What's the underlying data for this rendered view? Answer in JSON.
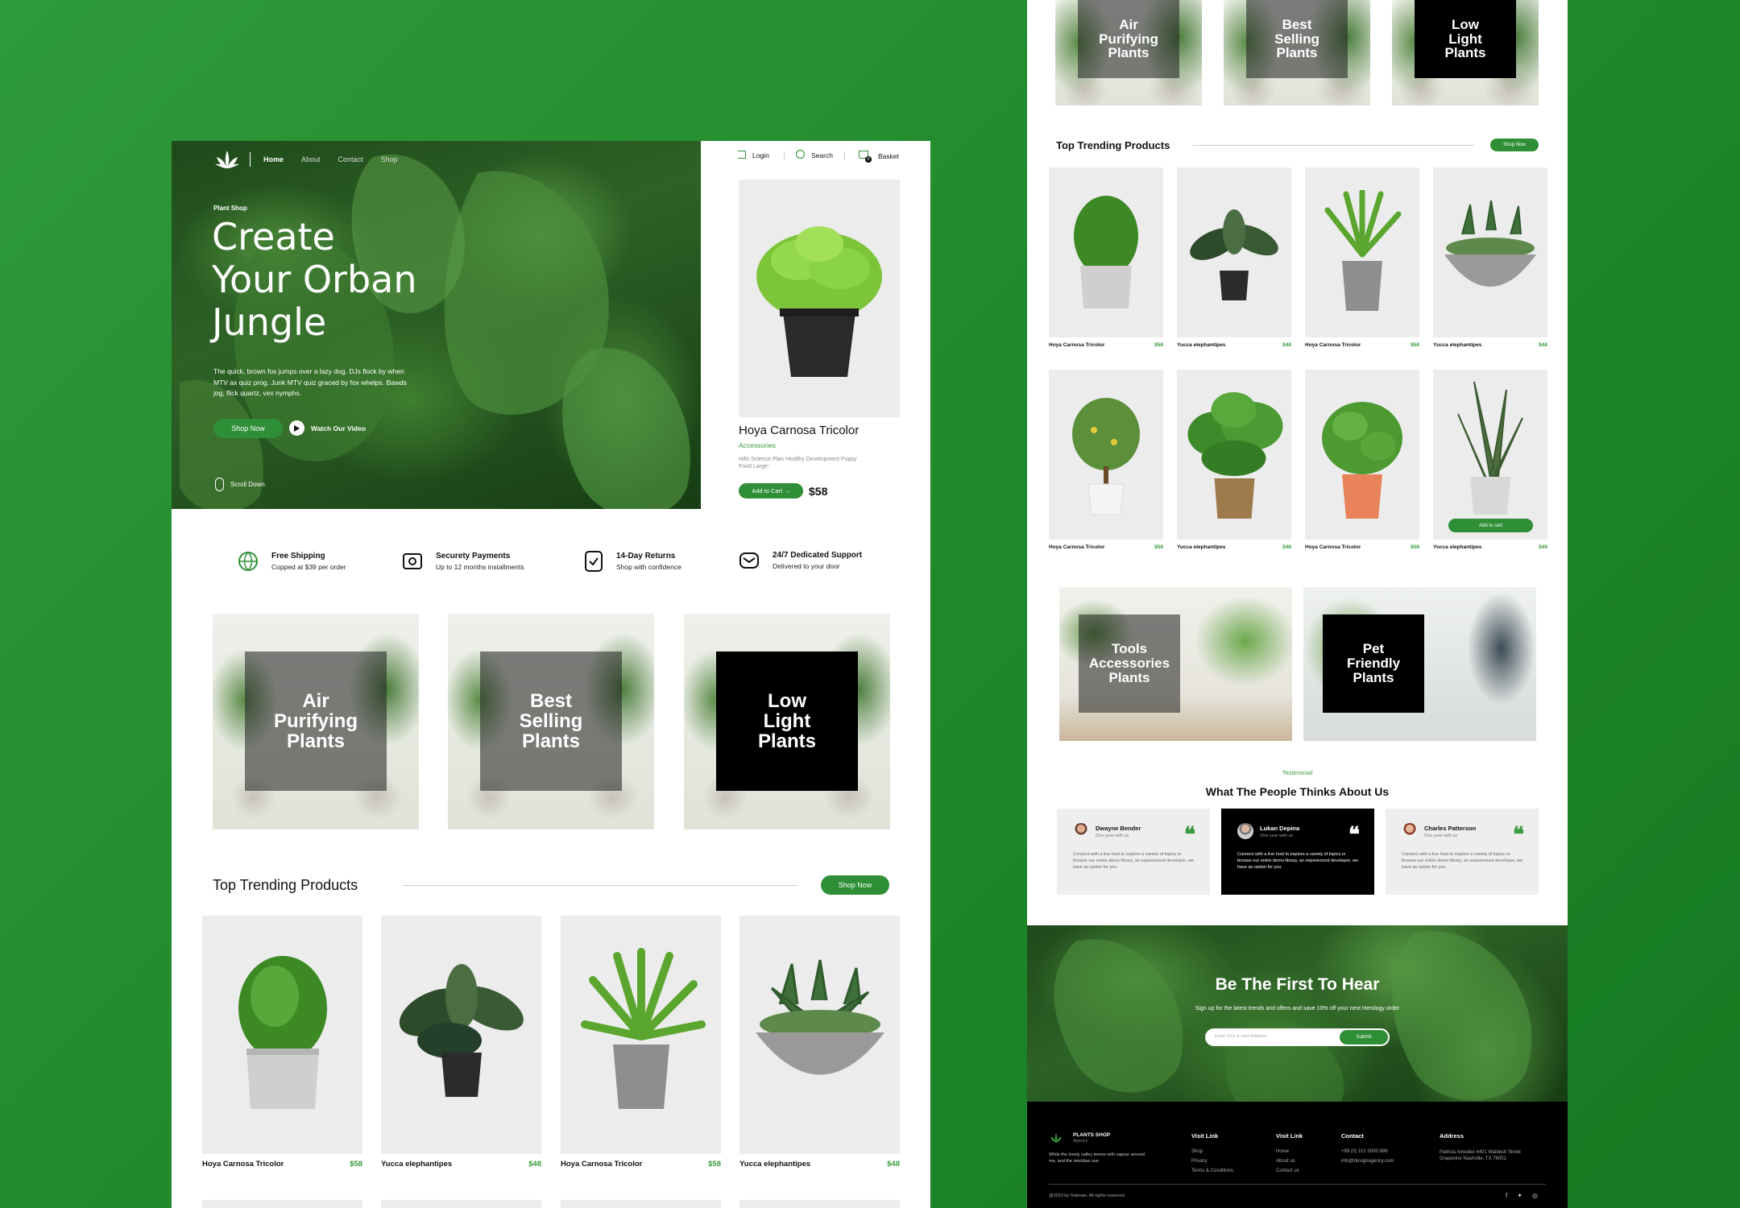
{
  "colors": {
    "brand": "#2e8f36",
    "price": "#3a9a3e",
    "bg": "#228a2c"
  },
  "nav": {
    "links": [
      "Home",
      "About",
      "Contact",
      "Shop"
    ],
    "login": "Login",
    "search": "Search",
    "basket": "Basket",
    "basket_count": "0"
  },
  "hero": {
    "eyebrow": "Plant Shop",
    "title_l1": "Create",
    "title_l2": "Your Orban",
    "title_l3": "Jungle",
    "desc": "The quick, brown fox jumps over a lazy dog. DJs flock by when MTV ax quiz prog. Junk MTV quiz graced by fox whelps. Bawds jog, flick quartz, vex nymphs.",
    "cta": "Shop Now",
    "video": "Watch Our Video",
    "scroll": "Scroll Down"
  },
  "featured": {
    "name": "Hoya Carnosa Tricolor",
    "category": "Accessories",
    "desc": "Hills Science Plan Healthy Development Puppy Food Large-",
    "cart": "Add to Cart →",
    "price": "$58"
  },
  "features": [
    {
      "title": "Free Shipping",
      "sub": "Copped at $39 per order",
      "icon": "globe-icon"
    },
    {
      "title": "Securety Payments",
      "sub": "Up to 12 months installments",
      "icon": "payment-icon"
    },
    {
      "title": "14-Day Returns",
      "sub": "Shop with confidence",
      "icon": "returns-icon"
    },
    {
      "title": "24/7 Dedicated Support",
      "sub": "Delivered to  your door",
      "icon": "support-icon"
    }
  ],
  "categories": [
    {
      "l1": "Air",
      "l2": "Purifying",
      "l3": "Plants"
    },
    {
      "l1": "Best",
      "l2": "Selling",
      "l3": "Plants"
    },
    {
      "l1": "Low",
      "l2": "Light",
      "l3": "Plants"
    }
  ],
  "trending": {
    "title": "Top Trending Products",
    "cta": "Shop Now"
  },
  "products": [
    {
      "name": "Hoya Carnosa Tricolor",
      "price": "$58"
    },
    {
      "name": "Yucca elephantipes",
      "price": "$48"
    },
    {
      "name": "Hoya Carnosa Tricolor",
      "price": "$58"
    },
    {
      "name": "Yucca elephantipes",
      "price": "$48"
    }
  ],
  "products_row2": [
    {
      "name": "Hoya Carnosa Tricolor",
      "price": "$58"
    },
    {
      "name": "Yucca elephantipes",
      "price": "$48"
    },
    {
      "name": "Hoya Carnosa Tricolor",
      "price": "$58"
    },
    {
      "name": "Yucca elephantipes",
      "price": "$49"
    }
  ],
  "add_to_cart": "Add to cart",
  "promo": [
    {
      "l1": "Tools",
      "l2": "Accessories",
      "l3": "Plants"
    },
    {
      "l1": "Pet",
      "l2": "Friendly",
      "l3": "Plants"
    }
  ],
  "testimonial": {
    "eyebrow": "Testimonial",
    "title": "What The People Thinks About Us",
    "items": [
      {
        "name": "Dwayne Bender",
        "sub": "One year with us",
        "text": "Connect with a live host to explore a variety of topics or browse our entire demo library, an experienced developer, we have an option for you"
      },
      {
        "name": "Lukan Depina",
        "sub": "One year with us",
        "text": "Connect with a live host to explore a variety of topics or browse our entire demo library, an experienced developer, we have an option for you"
      },
      {
        "name": "Charles Patterson",
        "sub": "One year with us",
        "text": "Connect with a live host to explore a variety of topics or browse our entire demo library, an experienced developer, we have an option for you"
      }
    ]
  },
  "newsletter": {
    "title": "Be The First To Hear",
    "sub": "Sign up for the latest trends and offers and save 10% off your next Herology order",
    "placeholder": "Enter Your E-mail Address",
    "submit": "Submit"
  },
  "footer": {
    "brand": "PLANTS SHOP",
    "brand_sub": "Agency",
    "tagline": "While the lovely valley teems with vapour around me, and the meridian sun",
    "col1": {
      "title": "Visit Link",
      "links": [
        "Shop",
        "Privacy",
        "Terms & Conditions"
      ]
    },
    "col2": {
      "title": "Visit Link",
      "links": [
        "Home",
        "About us",
        "Contact us"
      ]
    },
    "col3": {
      "title": "Contact",
      "links": [
        "+99 (0) 101 0000 888",
        "info@designagency.com"
      ]
    },
    "col4": {
      "title": "Address",
      "text": "Patricia Amedee 4401 Waldeck Street Grapevine Nashville, TX 76051"
    },
    "copyright": "@2023 by Sokman. All rights reserved."
  }
}
